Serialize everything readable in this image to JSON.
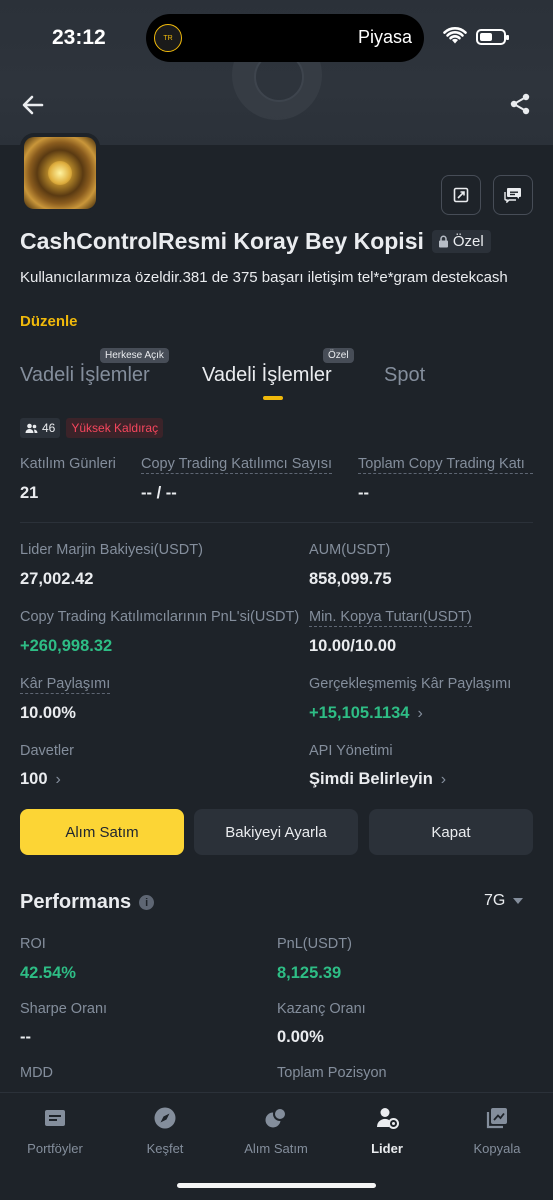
{
  "status_bar": {
    "time": "23:12",
    "island_logo": "TR",
    "island_text": "Piyasa"
  },
  "profile": {
    "title": "CashControlResmi Koray Bey Kopisi",
    "private_badge": "Özel",
    "description": "Kullanıcılarımıza özeldir.381 de 375 başarı iletişim tel*e*gram destekcash",
    "edit_label": "Düzenle"
  },
  "tabs": [
    {
      "label": "Vadeli İşlemler",
      "badge": "Herkese Açık",
      "active": false
    },
    {
      "label": "Vadeli İşlemler",
      "badge": "Özel",
      "active": true
    },
    {
      "label": "Spot",
      "badge": "",
      "active": false
    }
  ],
  "chips": {
    "followers": "46",
    "leverage": "Yüksek Kaldıraç"
  },
  "stats": {
    "join_days_label": "Katılım Günleri",
    "join_days_value": "21",
    "copiers_label": "Copy Trading Katılımcı Sayısı",
    "copiers_value": "-- / --",
    "total_copy_label": "Toplam Copy Trading Katı",
    "total_copy_value": "--",
    "margin_label": "Lider Marjin Bakiyesi(USDT)",
    "margin_value": "27,002.42",
    "aum_label": "AUM(USDT)",
    "aum_value": "858,099.75",
    "copier_pnl_label": "Copy Trading Katılımcılarının PnL'si(USDT)",
    "copier_pnl_value": "+260,998.32",
    "min_copy_label": "Min. Kopya Tutarı(USDT)",
    "min_copy_value": "10.00/10.00",
    "profit_share_label": "Kâr Paylaşımı",
    "profit_share_value": "10.00%",
    "unrealized_label": "Gerçekleşmemiş Kâr Paylaşımı",
    "unrealized_value": "+15,105.1134",
    "invites_label": "Davetler",
    "invites_value": "100",
    "api_label": "API Yönetimi",
    "api_value": "Şimdi Belirleyin"
  },
  "actions": {
    "trade": "Alım Satım",
    "adjust": "Bakiyeyi Ayarla",
    "close": "Kapat"
  },
  "performance": {
    "title": "Performans",
    "period": "7G",
    "roi_label": "ROI",
    "roi_value": "42.54%",
    "pnl_label": "PnL(USDT)",
    "pnl_value": "8,125.39",
    "sharpe_label": "Sharpe Oranı",
    "sharpe_value": "--",
    "win_label": "Kazanç Oranı",
    "win_value": "0.00%",
    "mdd_label": "MDD",
    "positions_label": "Toplam Pozisyon"
  },
  "bottom_nav": [
    {
      "label": "Portföyler",
      "icon": "portfolio-icon",
      "active": false
    },
    {
      "label": "Keşfet",
      "icon": "compass-icon",
      "active": false
    },
    {
      "label": "Alım Satım",
      "icon": "trade-icon",
      "active": false
    },
    {
      "label": "Lider",
      "icon": "leader-icon",
      "active": true
    },
    {
      "label": "Kopyala",
      "icon": "copy-icon",
      "active": false
    }
  ],
  "colors": {
    "background": "#1e2329",
    "accent": "#fcd535",
    "positive": "#2ebd85",
    "negative": "#f6465d"
  }
}
